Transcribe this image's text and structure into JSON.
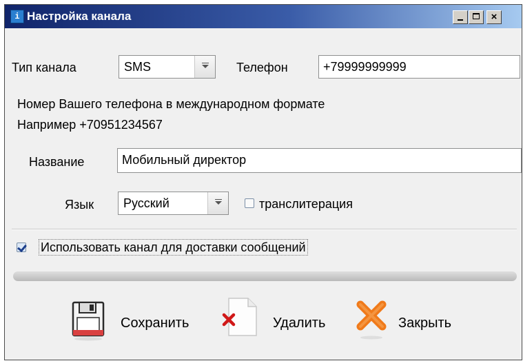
{
  "window": {
    "title": "Настройка канала",
    "app_icon": "channel-app-icon",
    "controls": {
      "minimize": "minimize-icon",
      "maximize": "maximize-icon",
      "close": "×"
    }
  },
  "channel_type": {
    "label": "Тип канала",
    "value": "SMS"
  },
  "phone": {
    "label": "Телефон",
    "value": "+79999999999"
  },
  "hint": {
    "line1": "Номер Вашего телефона в международном формате",
    "line2": "Например +70951234567"
  },
  "name": {
    "label": "Название",
    "value": "Мобильный директор"
  },
  "language": {
    "label": "Язык",
    "value": "Русский"
  },
  "transliteration": {
    "label": "транслитерация",
    "checked": false
  },
  "use_channel": {
    "label": "Использовать канал для доставки сообщений",
    "checked": true
  },
  "buttons": {
    "save": {
      "label": "Сохранить",
      "icon": "floppy-disk-icon"
    },
    "delete": {
      "label": "Удалить",
      "icon": "delete-document-icon"
    },
    "close": {
      "label": "Закрыть",
      "icon": "close-x-icon"
    }
  },
  "colors": {
    "title_start": "#10246a",
    "title_end": "#a6caf0",
    "delete_red": "#d01818",
    "close_orange": "#f07a1a"
  }
}
